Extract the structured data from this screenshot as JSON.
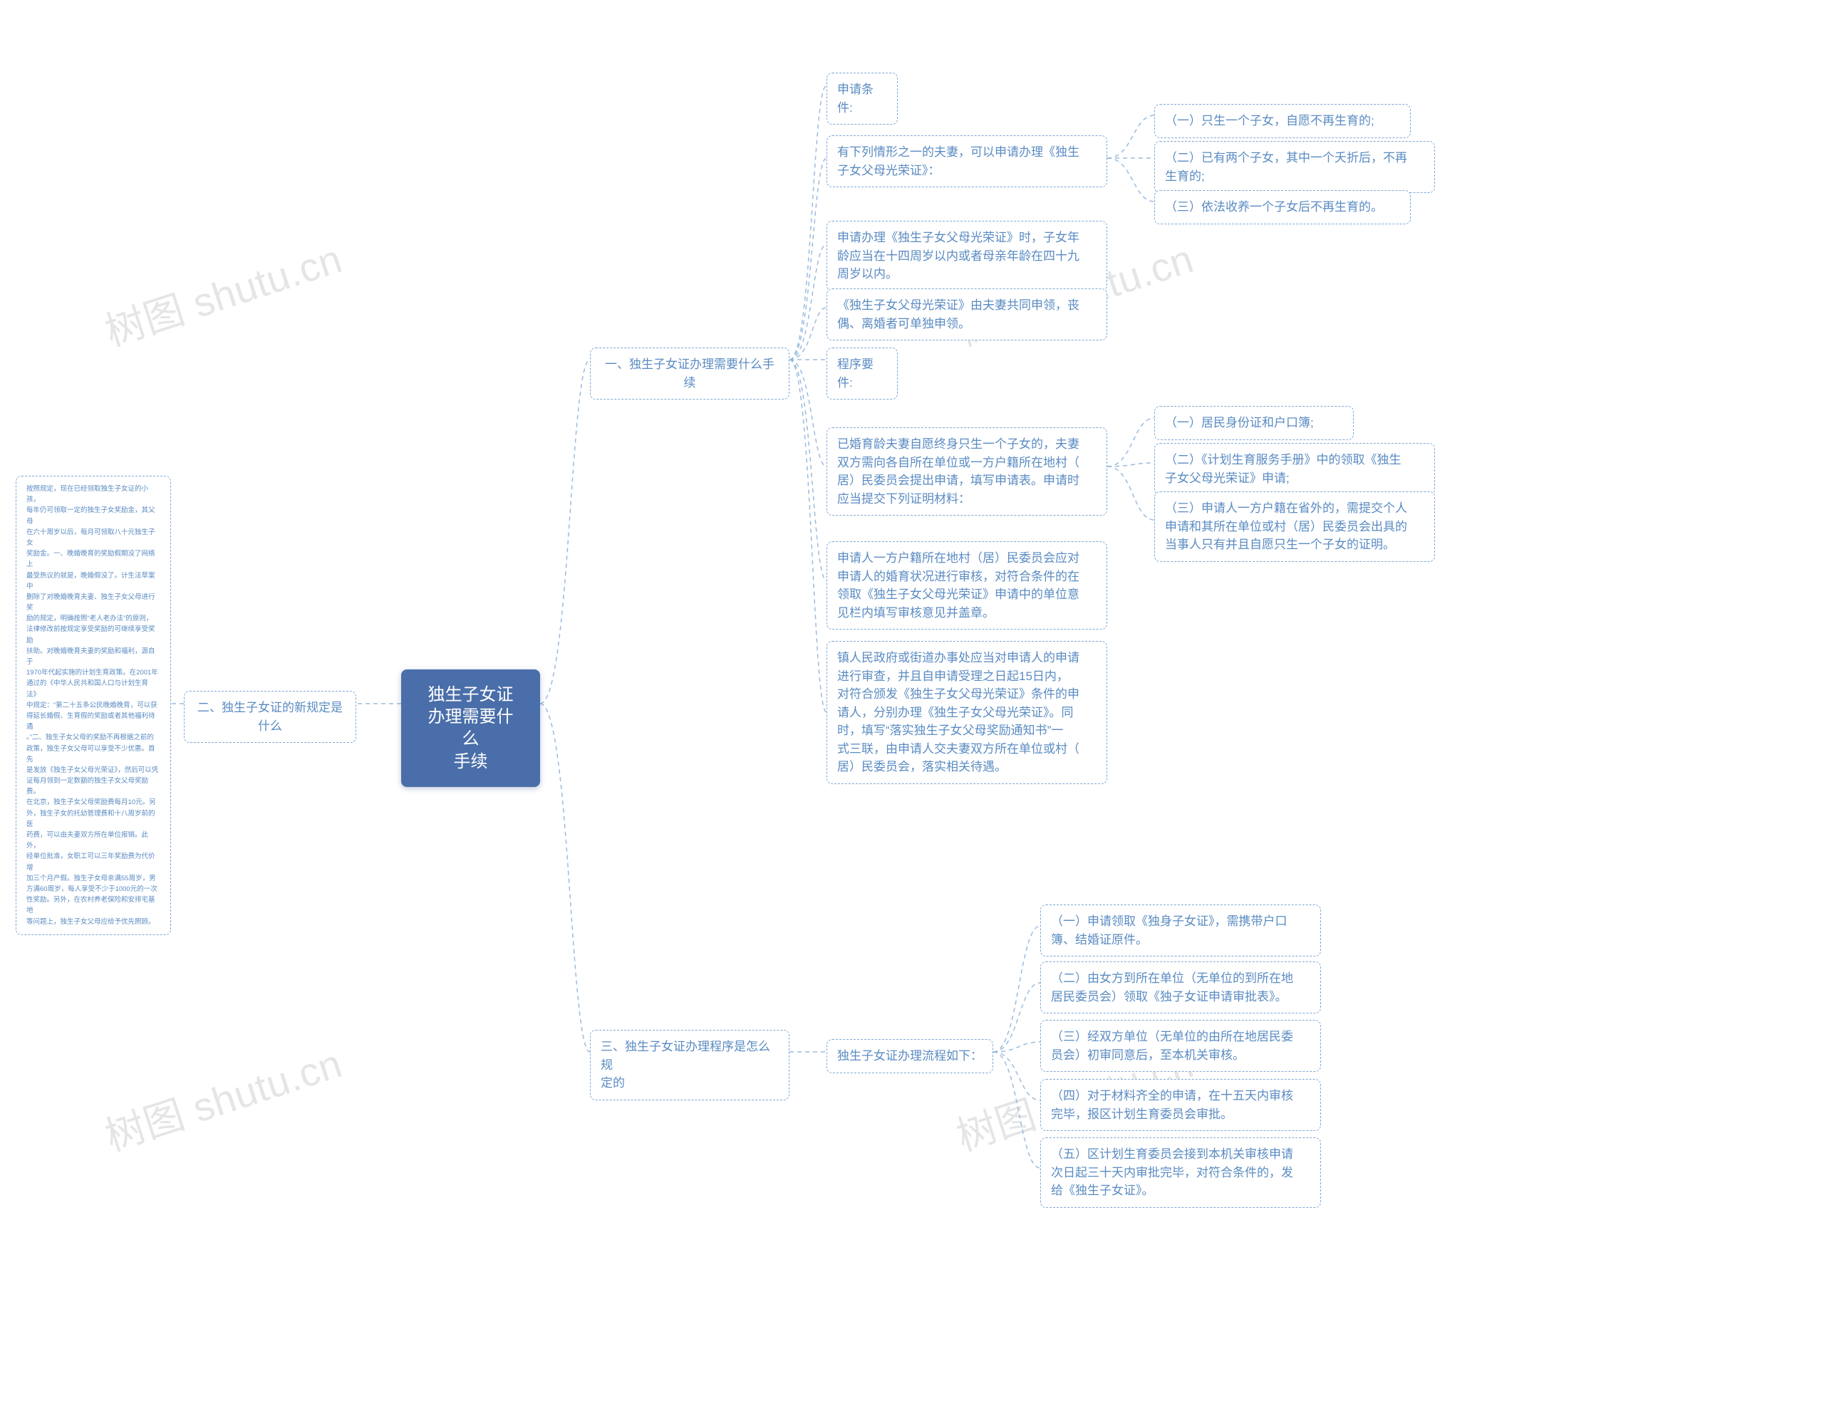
{
  "watermarks": {
    "text": "树图 shutu.cn"
  },
  "root": {
    "title": "独生子女证办理需要什么\n手续"
  },
  "l2": {
    "s1": "一、独生子女证办理需要什么手续",
    "s2": "二、独生子女证的新规定是什么",
    "s3": "三、独生子女证办理程序是怎么规\n定的"
  },
  "s1": {
    "a": "申请条件:",
    "a1": "有下列情形之一的夫妻，可以申请办理《独生\n子女父母光荣证》：",
    "a1_1": "（一）只生一个子女，自愿不再生育的;",
    "a1_2": "（二）已有两个子女，其中一个夭折后，不再\n生育的;",
    "a1_3": "（三）依法收养一个子女后不再生育的。",
    "a2": "申请办理《独生子女父母光荣证》时，子女年\n龄应当在十四周岁以内或者母亲年龄在四十九\n周岁以内。",
    "a3": "《独生子女父母光荣证》由夫妻共同申领，丧\n偶、离婚者可单独申领。",
    "b": "程序要件:",
    "b1": "已婚育龄夫妻自愿终身只生一个子女的，夫妻\n双方需向各自所在单位或一方户籍所在地村（\n居）民委员会提出申请，填写申请表。申请时\n应当提交下列证明材料：",
    "b1_1": "（一）居民身份证和户口簿;",
    "b1_2": "（二）《计划生育服务手册》中的领取《独生\n子女父母光荣证》申请;",
    "b1_3": "（三）申请人一方户籍在省外的，需提交个人\n申请和其所在单位或村（居）民委员会出具的\n当事人只有并且自愿只生一个子女的证明。",
    "b2": "申请人一方户籍所在地村（居）民委员会应对\n申请人的婚育状况进行审核，对符合条件的在\n领取《独生子女父母光荣证》申请中的单位意\n见栏内填写审核意见并盖章。",
    "b3": "镇人民政府或街道办事处应当对申请人的申请\n进行审查，并且自申请受理之日起15日内，\n对符合颁发《独生子女父母光荣证》条件的申\n请人，分别办理《独生子女父母光荣证》。同\n时，填写“落实独生子女父母奖励通知书”一\n式三联，由申请人交夫妻双方所在单位或村（\n居）民委员会，落实相关待遇。"
  },
  "s2": {
    "body": "按照规定，现在已经领取独生子女证的小孩，\n每年仍可领取一定的独生子女奖励金，其父母\n在六十周岁以后，每月可领取八十元独生子女\n奖励金。一、晚婚晚育的奖励假期没了网络上\n最受热议的就是，晚婚假没了。计生法草案中\n删除了对晚婚晚育夫妻、独生子女父母进行奖\n励的规定，明确按照“老人老办法”的原则，\n法律修改前按规定享受奖励的可继续享受奖励\n扶助。对晚婚晚育夫妻的奖励和福利，源自于\n1970年代起实施的计划生育政策。在2001年\n通过的《中华人民共和国人口与计划生育法》\n中规定：“第二十五条公民晚婚晚育，可以获\n得延长婚假、生育假的奖励或者其他福利待遇\n。”二、独生子女父母的奖励不再根据之前的\n政策，独生子女父母可以享受不少优惠。首先\n是发放《独生子女父母光荣证》，然后可以凭\n证每月领到一定数额的独生子女父母奖励费。\n在北京，独生子女父母奖励费每月10元。另\n外，独生子女的托幼管理费和十八周岁前的医\n药费，可以由夫妻双方所在单位报销。此外，\n经单位批准，女职工可以三年奖励费为代价增\n加三个月产假。独生子女母亲满55周岁，男\n方满60周岁，每人享受不少于1000元的一次\n性奖励。另外，在农村养老保险和安排宅基地\n等问题上，独生子女父母应给予优先照顾。"
  },
  "s3": {
    "head": "独生子女证办理流程如下：",
    "i1": "（一）申请领取《独身子女证》，需携带户口\n簿、结婚证原件。",
    "i2": "（二）由女方到所在单位（无单位的到所在地\n居民委员会）领取《独子女证申请审批表》。",
    "i3": "（三）经双方单位（无单位的由所在地居民委\n员会）初审同意后，至本机关审核。",
    "i4": "（四）对于材料齐全的申请，在十五天内审核\n完毕，报区计划生育委员会审批。",
    "i5": "（五）区计划生育委员会接到本机关审核申请\n次日起三十天内审批完毕，对符合条件的，发\n给《独生子女证》。"
  }
}
